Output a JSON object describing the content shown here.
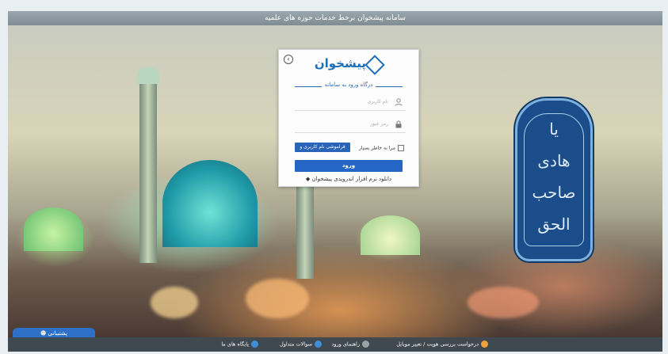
{
  "window": {
    "title": "سامانه پیشخوان برخط خدمات حوزه های علمیه"
  },
  "login": {
    "logo_text": "پیشخوان",
    "subtitle": "درگاه ورود به سامانه",
    "username_placeholder": "نام کاربری",
    "password_placeholder": "رمز عبور",
    "remember_label": "مرا به خاطر بسپار",
    "forgot_label": "فراموشی نام کاربری و رمزعبور",
    "enter_label": "ورود",
    "android_label": "دانلود نرم افزار اندرویدی پیشخوان",
    "back_icon_glyph": "›"
  },
  "badge": {
    "calligraphy": [
      "یا",
      "هادی",
      "صاحب",
      "الحق"
    ]
  },
  "support": {
    "label": "پشتیبانی"
  },
  "footer": {
    "items": [
      {
        "label": "درخواست بررسی هویت / تغییر موبایل",
        "color": "#f0a23a"
      },
      {
        "label": "راهنمای ورود",
        "color": "#9aa3a8"
      },
      {
        "label": "سوالات متداول",
        "color": "#3d8fd9"
      },
      {
        "label": "پایگاه های ما",
        "color": "#3d8fd9"
      }
    ]
  },
  "colors": {
    "accent": "#2566c4",
    "footer_bg": "#3f494f"
  }
}
